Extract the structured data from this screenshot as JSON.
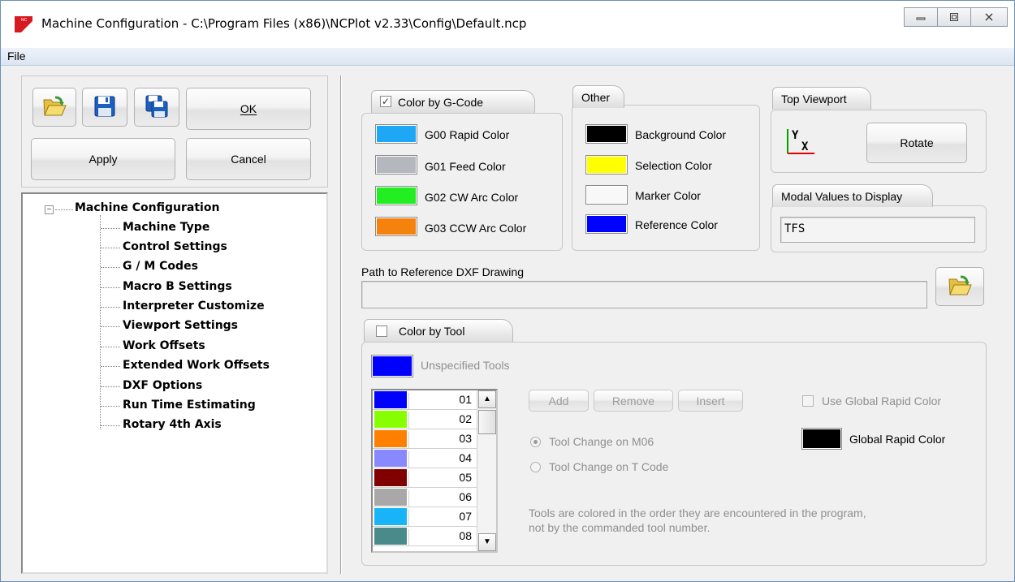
{
  "window": {
    "title": "Machine Configuration - C:\\Program Files (x86)\\NCPlot v2.33\\Config\\Default.ncp",
    "app_icon_text": "NC"
  },
  "menu": {
    "file": "File"
  },
  "buttons": {
    "ok": "OK",
    "apply": "Apply",
    "cancel": "Cancel",
    "rotate": "Rotate",
    "add": "Add",
    "remove": "Remove",
    "insert": "Insert"
  },
  "tree": {
    "root": "Machine Configuration",
    "items": [
      "Machine Type",
      "Control Settings",
      "G / M Codes",
      "Macro B Settings",
      "Interpreter Customize",
      "Viewport Settings",
      "Work Offsets",
      "Extended Work Offsets",
      "DXF Options",
      "Run Time Estimating",
      "Rotary 4th Axis"
    ]
  },
  "gcode_group": {
    "title": "Color by G-Code",
    "checked": true,
    "items": [
      {
        "label": "G00 Rapid Color",
        "color": "#1ea7f5"
      },
      {
        "label": "G01 Feed Color",
        "color": "#b4b8be"
      },
      {
        "label": "G02 CW Arc Color",
        "color": "#22ee22"
      },
      {
        "label": "G03 CCW Arc Color",
        "color": "#f5820c"
      }
    ]
  },
  "other_group": {
    "title": "Other",
    "items": [
      {
        "label": "Background Color",
        "color": "#000000"
      },
      {
        "label": "Selection Color",
        "color": "#ffff00"
      },
      {
        "label": "Marker Color",
        "color": "#f8f8f8"
      },
      {
        "label": "Reference Color",
        "color": "#0000ff"
      }
    ]
  },
  "top_viewport": {
    "title": "Top Viewport",
    "axis_y": "Y",
    "axis_x": "X"
  },
  "modal": {
    "title": "Modal Values to Display",
    "value": "TFS"
  },
  "dxf": {
    "label": "Path to Reference DXF Drawing",
    "value": ""
  },
  "tool_group": {
    "title": "Color by Tool",
    "checked": false,
    "unspecified_label": "Unspecified Tools",
    "unspecified_color": "#0000ff",
    "tools": [
      {
        "num": "01",
        "color": "#0000ff"
      },
      {
        "num": "02",
        "color": "#88ff00"
      },
      {
        "num": "03",
        "color": "#ff8000"
      },
      {
        "num": "04",
        "color": "#8888ff"
      },
      {
        "num": "05",
        "color": "#800000"
      },
      {
        "num": "06",
        "color": "#a8a8a8"
      },
      {
        "num": "07",
        "color": "#18b4f8"
      },
      {
        "num": "08",
        "color": "#4a8a8a"
      }
    ],
    "use_global_rapid": "Use Global Rapid Color",
    "global_rapid_label": "Global Rapid Color",
    "global_rapid_color": "#000000",
    "radio_m06": "Tool Change on M06",
    "radio_tcode": "Tool Change on T Code",
    "note_line1": "Tools are colored in the order they are encountered in the program,",
    "note_line2": "not by the commanded tool number."
  }
}
